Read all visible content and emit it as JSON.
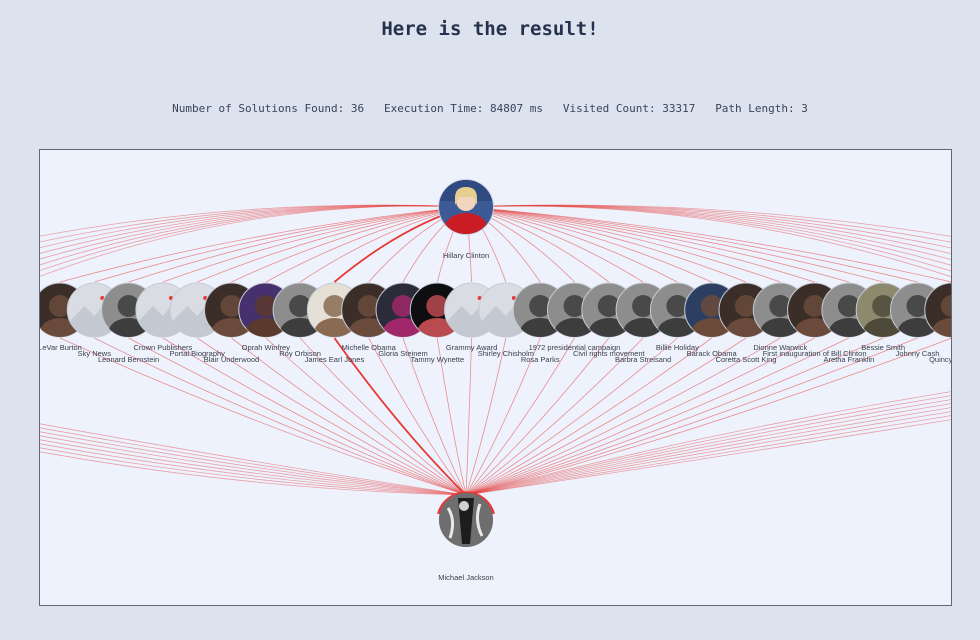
{
  "header": {
    "title": "Here is the result!"
  },
  "stats": {
    "solutions": "Number of Solutions Found: 36",
    "execution": "Execution Time: 84807 ms",
    "visited": "Visited Count: 33317",
    "path_length": "Path Length: 3"
  },
  "graph": {
    "source": {
      "label": "Hillary Clinton"
    },
    "target": {
      "label": "Michael Jackson"
    },
    "link_color": "#e53935",
    "intermediates": [
      {
        "label": "LeVar Burton",
        "img": "person-dark"
      },
      {
        "label": "Sky News",
        "img": "placeholder"
      },
      {
        "label": "Leonard Bernstein",
        "img": "person-bw"
      },
      {
        "label": "Crown Publishers",
        "img": "placeholder"
      },
      {
        "label": "Portal:Biography",
        "img": "placeholder"
      },
      {
        "label": "Blair Underwood",
        "img": "person-dark"
      },
      {
        "label": "Oprah Winfrey",
        "img": "person-purple"
      },
      {
        "label": "Roy Orbison",
        "img": "person-bw"
      },
      {
        "label": "James Earl Jones",
        "img": "person-light"
      },
      {
        "label": "Michelle Obama",
        "img": "person-dark"
      },
      {
        "label": "Gloria Steinem",
        "img": "person-magenta"
      },
      {
        "label": "Tammy Wynette",
        "img": "person-black"
      },
      {
        "label": "Grammy Award",
        "img": "placeholder"
      },
      {
        "label": "Shirley Chisholm",
        "img": "placeholder"
      },
      {
        "label": "Rosa Parks",
        "img": "person-bw"
      },
      {
        "label": "1972 presidential campaign",
        "img": "person-bw"
      },
      {
        "label": "Civil rights movement",
        "img": "person-bw"
      },
      {
        "label": "Barbra Streisand",
        "img": "person-bw"
      },
      {
        "label": "Billie Holiday",
        "img": "person-bw"
      },
      {
        "label": "Barack Obama",
        "img": "person-navy"
      },
      {
        "label": "Coretta Scott King",
        "img": "person-dark"
      },
      {
        "label": "Dionne Warwick",
        "img": "person-bw"
      },
      {
        "label": "First inauguration of Bill Clinton",
        "img": "person-dark"
      },
      {
        "label": "Aretha Franklin",
        "img": "person-bw"
      },
      {
        "label": "Bessie Smith",
        "img": "person-olive"
      },
      {
        "label": "Johnny Cash",
        "img": "person-bw"
      },
      {
        "label": "Quincy Jones",
        "img": "person-dark"
      }
    ]
  }
}
